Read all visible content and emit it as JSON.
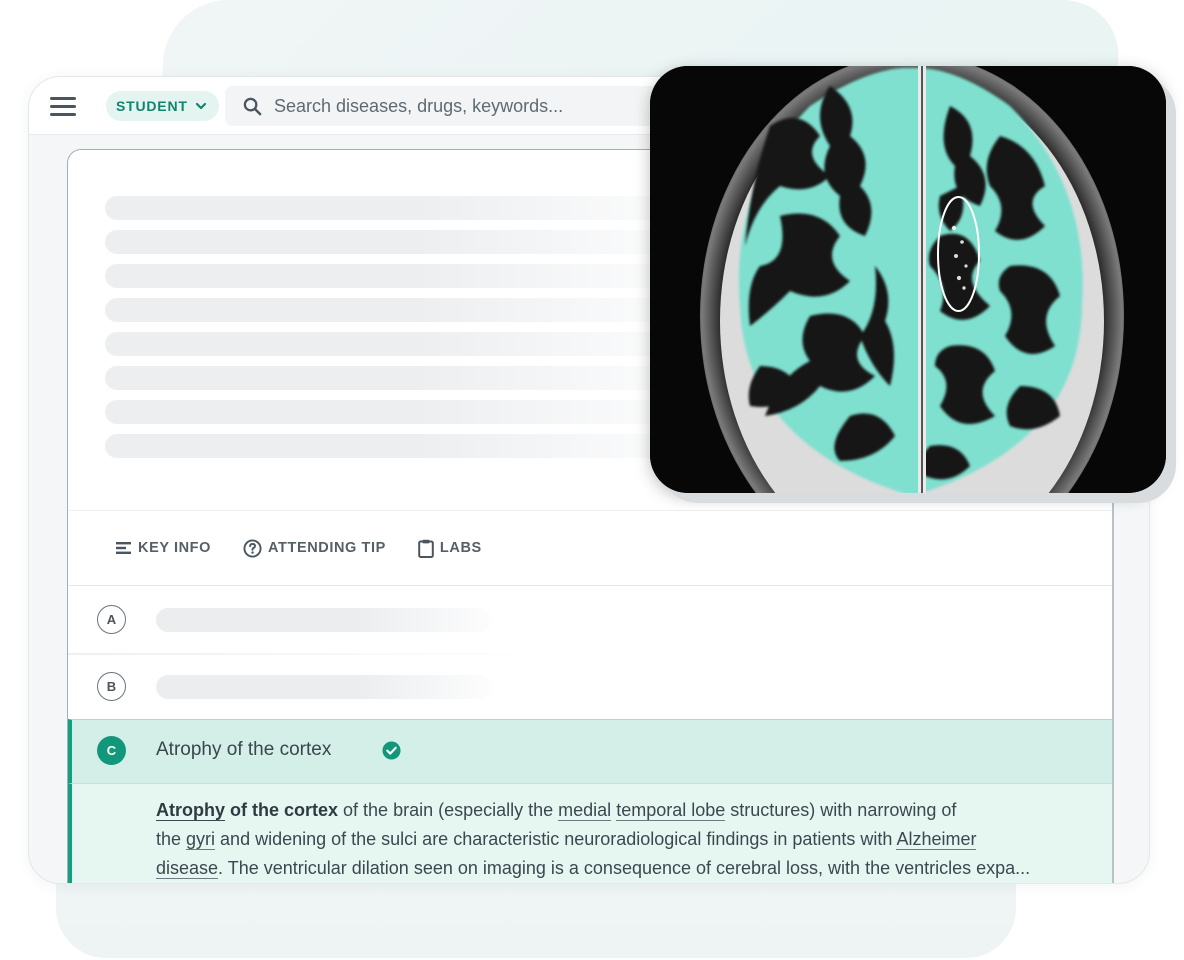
{
  "topbar": {
    "role": "STUDENT",
    "search_placeholder": "Search diseases, drugs, keywords..."
  },
  "tools": [
    {
      "label": "KEY INFO",
      "icon": "key-info-icon"
    },
    {
      "label": "ATTENDING TIP",
      "icon": "question-circle-icon"
    },
    {
      "label": "LABS",
      "icon": "clipboard-icon"
    }
  ],
  "options": [
    {
      "letter": "A"
    },
    {
      "letter": "B"
    },
    {
      "letter": "C",
      "text": "Atrophy of the cortex",
      "correct": true
    }
  ],
  "explanation": {
    "l1_link1": "Atrophy",
    "l1_bold": " of the cortex",
    "l1_t1": " of the brain (especially the ",
    "l1_link2": "medial",
    "l1_link3": "temporal lobe",
    "l1_t2": " structures) with narrowing of",
    "l2_t1": "the ",
    "l2_link1": "gyri",
    "l2_t2": " and widening of the sulci are characteristic neuroradiological findings in patients with ",
    "l2_link2": "Alzheimer",
    "l3_link1": "disease",
    "l3_t1": ". The ventricular dilation seen on imaging is a consequence of cerebral loss, with the ventricles expa..."
  },
  "colors": {
    "accent": "#14a07f",
    "correct_bg": "#d3efe7",
    "explanation_bg": "#e6f6f1",
    "mri_highlight": "#7fe0cf"
  }
}
